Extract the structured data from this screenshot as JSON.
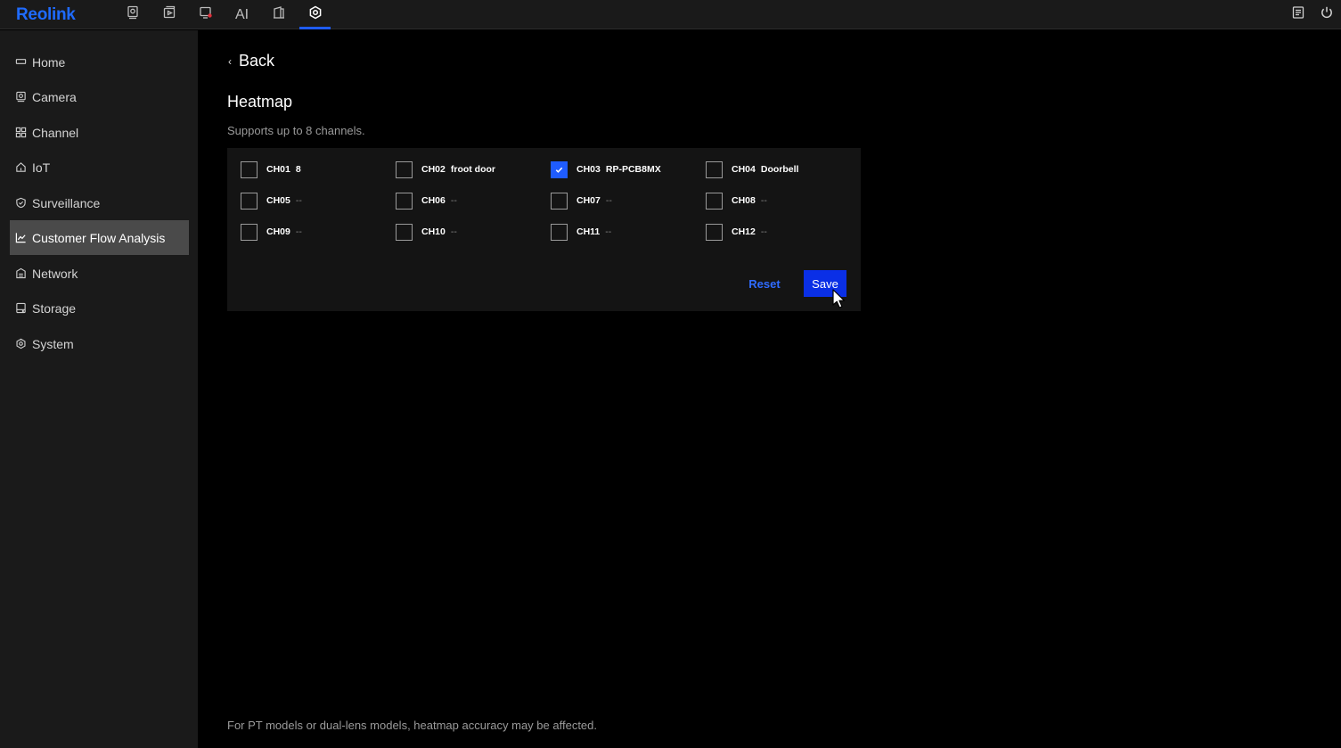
{
  "app": {
    "logo": "Reolink"
  },
  "topnav": {
    "items": [
      {
        "icon": "camera-preview-icon"
      },
      {
        "icon": "playback-icon"
      },
      {
        "icon": "alarm-icon"
      },
      {
        "label": "AI"
      },
      {
        "icon": "door-icon"
      },
      {
        "icon": "settings-icon",
        "active": true
      }
    ],
    "right": [
      {
        "icon": "notes-icon"
      },
      {
        "icon": "power-icon"
      }
    ]
  },
  "sidebar": {
    "items": [
      {
        "label": "Home",
        "icon": "home-icon"
      },
      {
        "label": "Camera",
        "icon": "camera-icon"
      },
      {
        "label": "Channel",
        "icon": "grid-icon"
      },
      {
        "label": "IoT",
        "icon": "iot-home-icon"
      },
      {
        "label": "Surveillance",
        "icon": "shield-icon"
      },
      {
        "label": "Customer Flow Analysis",
        "icon": "chart-line-icon",
        "active": true
      },
      {
        "label": "Network",
        "icon": "network-icon"
      },
      {
        "label": "Storage",
        "icon": "storage-icon"
      },
      {
        "label": "System",
        "icon": "gear-icon"
      }
    ]
  },
  "main": {
    "back_label": "Back",
    "title": "Heatmap",
    "subtitle": "Supports up to 8 channels.",
    "channels": [
      {
        "code": "CH01",
        "name": "8",
        "checked": false
      },
      {
        "code": "CH02",
        "name": "froot door",
        "checked": false
      },
      {
        "code": "CH03",
        "name": "RP-PCB8MX",
        "checked": true
      },
      {
        "code": "CH04",
        "name": "Doorbell",
        "checked": false
      },
      {
        "code": "CH05",
        "name": "--",
        "checked": false
      },
      {
        "code": "CH06",
        "name": "--",
        "checked": false
      },
      {
        "code": "CH07",
        "name": "--",
        "checked": false
      },
      {
        "code": "CH08",
        "name": "--",
        "checked": false
      },
      {
        "code": "CH09",
        "name": "--",
        "checked": false
      },
      {
        "code": "CH10",
        "name": "--",
        "checked": false
      },
      {
        "code": "CH11",
        "name": "--",
        "checked": false
      },
      {
        "code": "CH12",
        "name": "--",
        "checked": false
      }
    ],
    "reset_label": "Reset",
    "save_label": "Save",
    "footnote": "For PT models or dual-lens models, heatmap accuracy may be affected."
  },
  "colors": {
    "accent": "#1f5cff",
    "save_bg": "#0a2fe6",
    "sidebar_active": "#4a4a4a"
  }
}
